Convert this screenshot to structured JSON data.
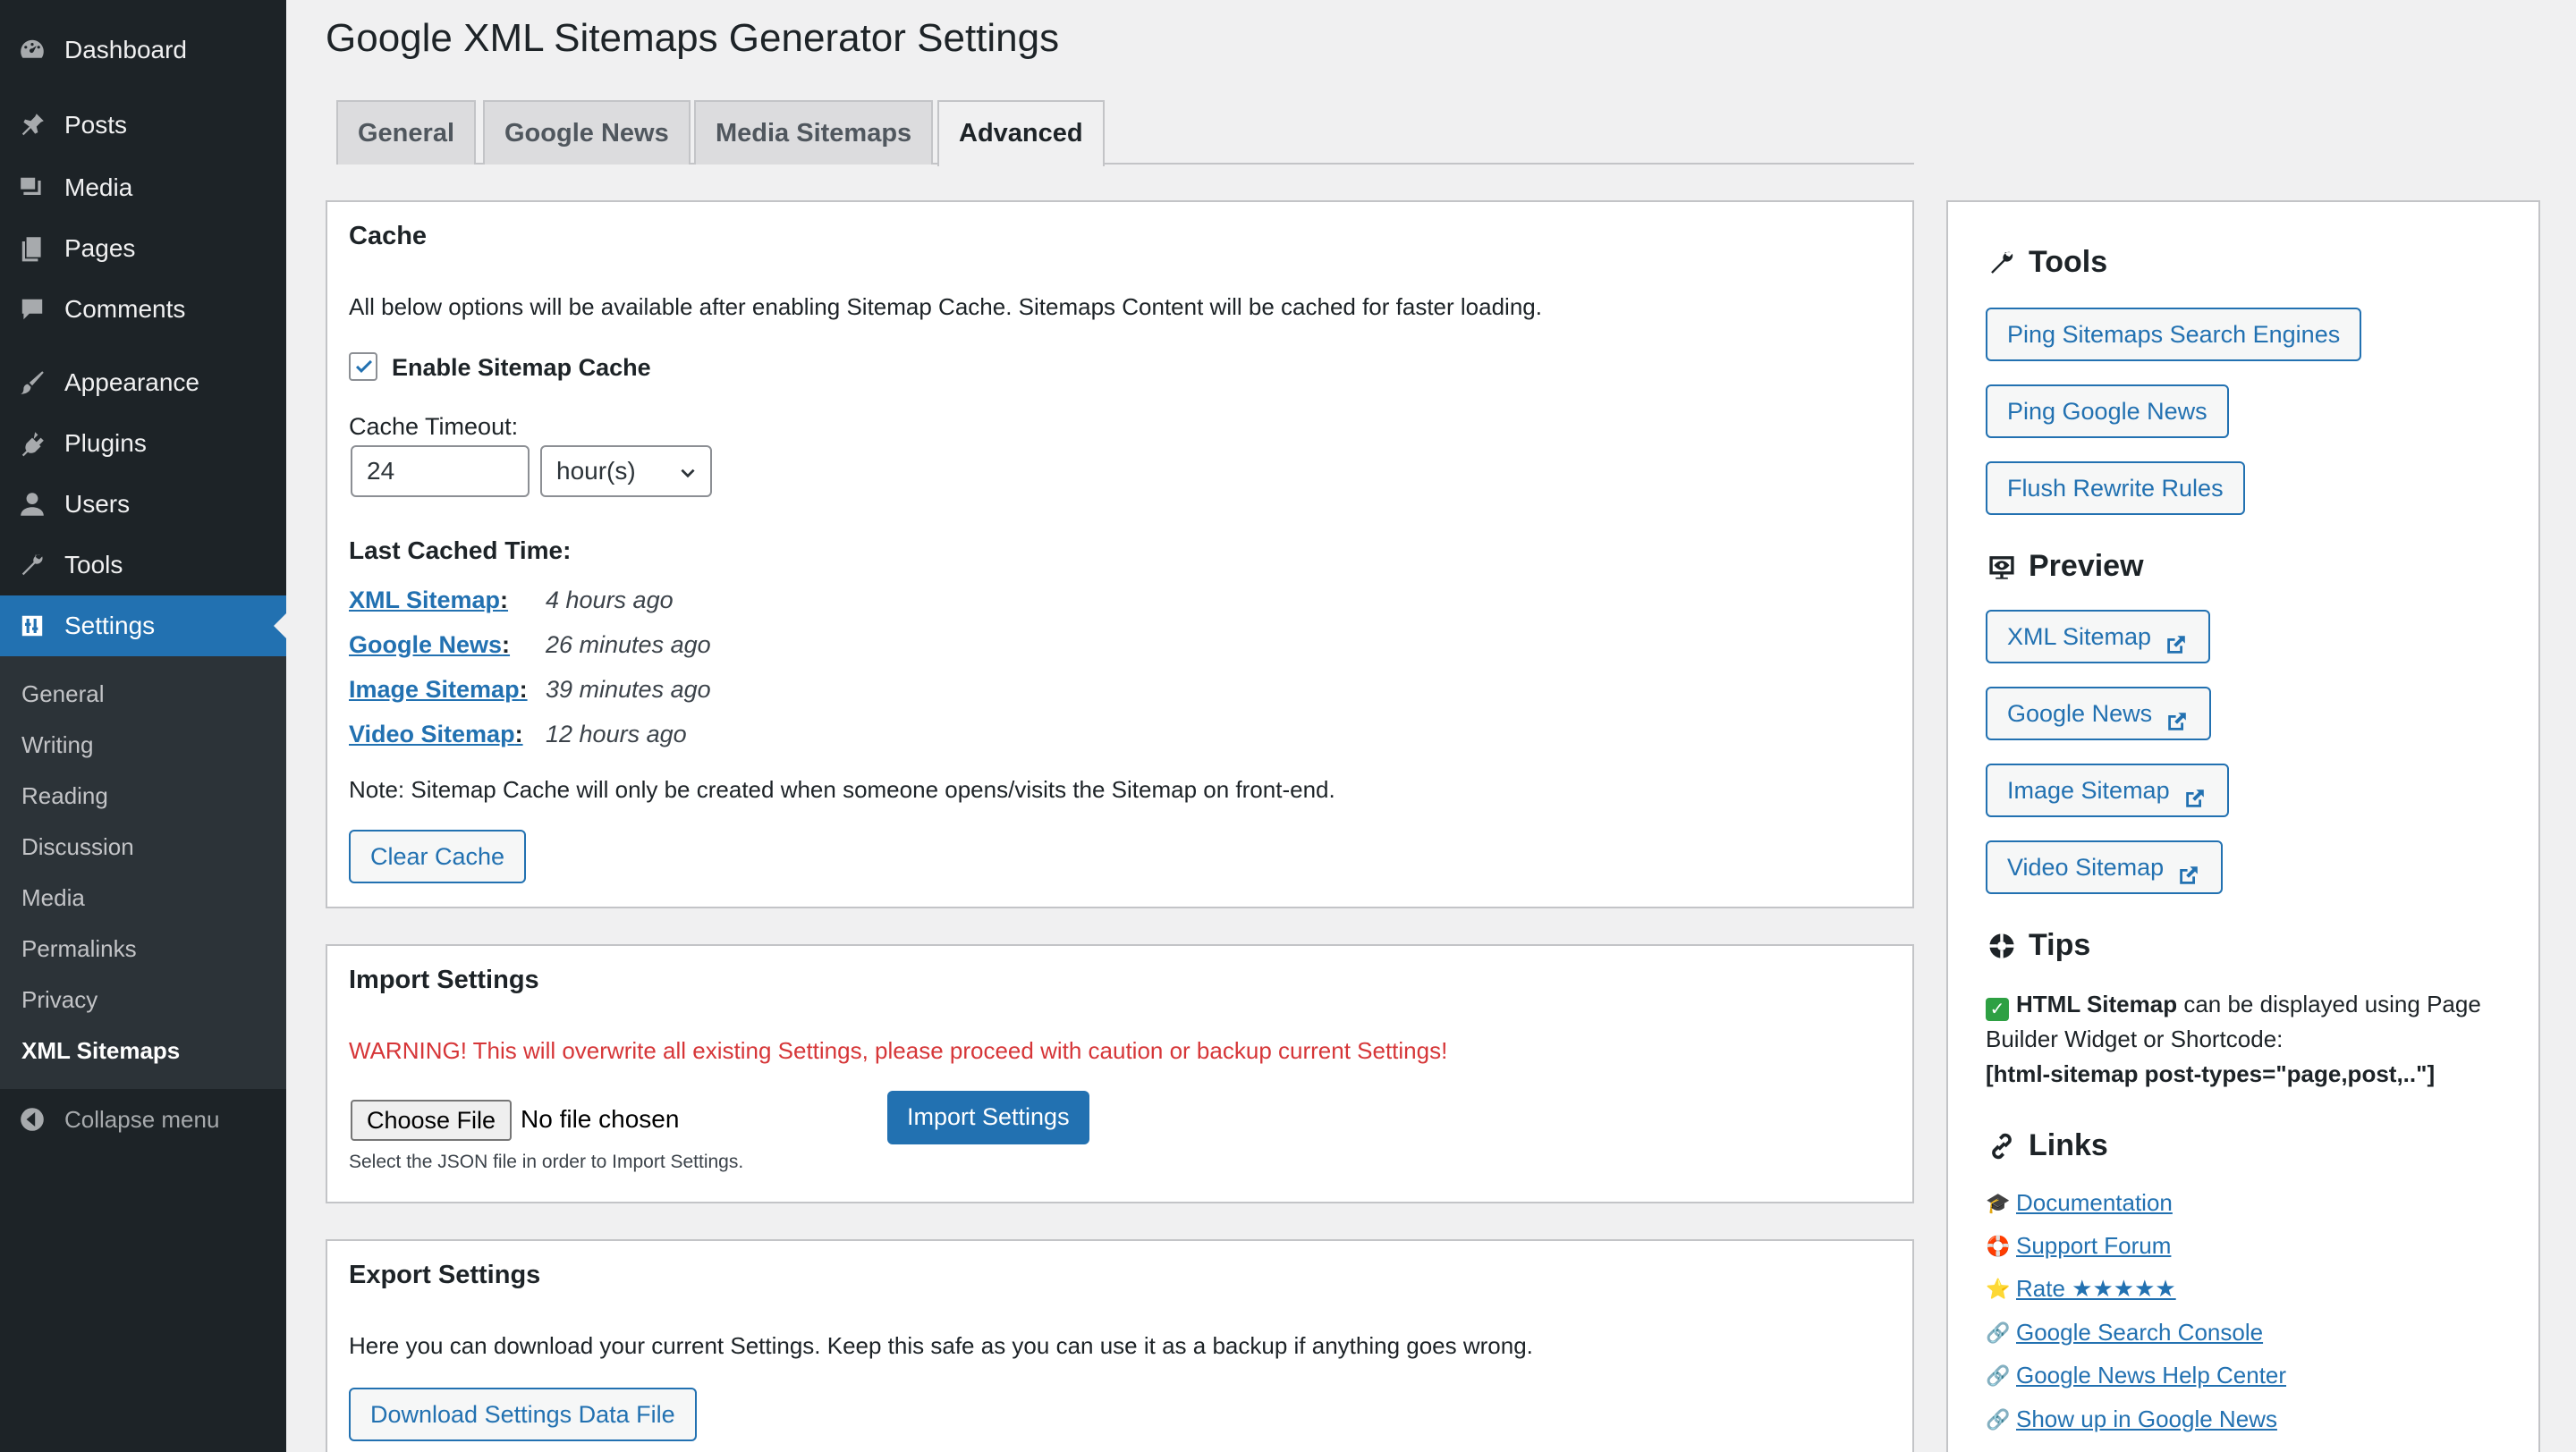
{
  "sidebar": {
    "menu": [
      {
        "label": "Dashboard",
        "icon": "dashboard-icon"
      },
      {
        "label": "Posts",
        "icon": "pin-icon"
      },
      {
        "label": "Media",
        "icon": "media-icon"
      },
      {
        "label": "Pages",
        "icon": "pages-icon"
      },
      {
        "label": "Comments",
        "icon": "comment-icon"
      },
      {
        "label": "Appearance",
        "icon": "brush-icon"
      },
      {
        "label": "Plugins",
        "icon": "plugin-icon"
      },
      {
        "label": "Users",
        "icon": "user-icon"
      },
      {
        "label": "Tools",
        "icon": "wrench-icon"
      },
      {
        "label": "Settings",
        "icon": "settings-icon"
      }
    ],
    "submenu": [
      "General",
      "Writing",
      "Reading",
      "Discussion",
      "Media",
      "Permalinks",
      "Privacy",
      "XML Sitemaps"
    ],
    "collapse": "Collapse menu"
  },
  "page": {
    "title": "Google XML Sitemaps Generator Settings",
    "tabs": [
      "General",
      "Google News",
      "Media Sitemaps",
      "Advanced"
    ],
    "active_tab": "Advanced"
  },
  "cache": {
    "heading": "Cache",
    "description": "All below options will be available after enabling Sitemap Cache. Sitemaps Content will be cached for faster loading.",
    "enable_label": "Enable Sitemap Cache",
    "enabled": true,
    "timeout_label": "Cache Timeout:",
    "timeout_value": "24",
    "timeout_unit": "hour(s)",
    "last_cached_label": "Last Cached Time:",
    "items": [
      {
        "name": "XML Sitemap",
        "time": "4 hours ago"
      },
      {
        "name": "Google News",
        "time": "26 minutes ago"
      },
      {
        "name": "Image Sitemap",
        "time": "39 minutes ago"
      },
      {
        "name": "Video Sitemap",
        "time": "12 hours ago"
      }
    ],
    "note": "Note: Sitemap Cache will only be created when someone opens/visits the Sitemap on front-end.",
    "clear_button": "Clear Cache"
  },
  "import": {
    "heading": "Import Settings",
    "warning": "WARNING! This will overwrite all existing Settings, please proceed with caution or backup current Settings!",
    "choose_file": "Choose File",
    "no_file": "No file chosen",
    "import_button": "Import Settings",
    "help": "Select the JSON file in order to Import Settings."
  },
  "export": {
    "heading": "Export Settings",
    "description": "Here you can download your current Settings. Keep this safe as you can use it as a backup if anything goes wrong.",
    "download_button": "Download Settings Data File"
  },
  "side": {
    "tools_heading": "Tools",
    "tools_buttons": [
      "Ping Sitemaps Search Engines",
      "Ping Google News",
      "Flush Rewrite Rules"
    ],
    "preview_heading": "Preview",
    "preview_buttons": [
      "XML Sitemap",
      "Google News",
      "Image Sitemap",
      "Video Sitemap"
    ],
    "tips_heading": "Tips",
    "tip_bold": "HTML Sitemap",
    "tip_text": " can be displayed using Page Builder Widget or Shortcode:",
    "tip_code": "[html-sitemap post-types=\"page,post,..\"]",
    "links_heading": "Links",
    "links": [
      {
        "emoji": "🎓",
        "label": "Documentation"
      },
      {
        "emoji": "🛟",
        "label": "Support Forum"
      },
      {
        "emoji": "⭐",
        "label": "Rate ★★★★★"
      },
      {
        "emoji": "🔗",
        "label": "Google Search Console"
      },
      {
        "emoji": "🔗",
        "label": "Google News Help Center"
      },
      {
        "emoji": "🔗",
        "label": "Show up in Google News"
      }
    ]
  }
}
